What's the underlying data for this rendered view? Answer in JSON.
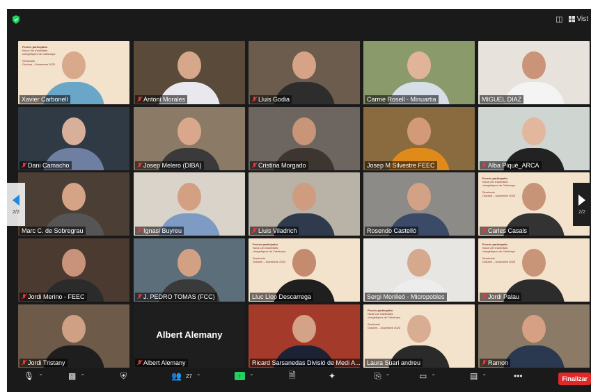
{
  "window": {
    "view_label": "Vist"
  },
  "pager": {
    "left_label": "2/2",
    "right_label": "2/2"
  },
  "participants": [
    {
      "name": "Xavier Carbonell",
      "muted": false,
      "bg": "#f3e2cc",
      "shirt": "#6aa6c7",
      "skin": "#d9a98b",
      "slide": true
    },
    {
      "name": "Antoni Morales",
      "muted": true,
      "bg": "#5a4a3a",
      "shirt": "#e8e8ee",
      "skin": "#d6a78a",
      "slide": false
    },
    {
      "name": "Lluis Godia",
      "muted": true,
      "bg": "#6b5c4d",
      "shirt": "#2d2d2d",
      "skin": "#d7a387",
      "slide": false
    },
    {
      "name": "Carme Rosell - Minuartia",
      "muted": false,
      "bg": "#8a9a6b",
      "shirt": "#d6dfe8",
      "skin": "#e1b49a",
      "slide": false
    },
    {
      "name": "MIGUEL DIAZ",
      "muted": false,
      "bg": "#e7e2dc",
      "shirt": "#f4f4f4",
      "skin": "#c99478",
      "slide": false
    },
    {
      "name": "Dani Camacho",
      "muted": true,
      "bg": "#2f3a44",
      "shirt": "#6f7fa2",
      "skin": "#d8b09a",
      "slide": false
    },
    {
      "name": "Josep Melero (DIBA)",
      "muted": true,
      "bg": "#8b7a66",
      "shirt": "#3a3a3a",
      "skin": "#d9a78c",
      "slide": false
    },
    {
      "name": "Cristina Morgado",
      "muted": true,
      "bg": "#6c6560",
      "shirt": "#3d3530",
      "skin": "#c89579",
      "slide": false
    },
    {
      "name": "Josep M Silvestre FEEC",
      "muted": false,
      "bg": "#8a6a3f",
      "shirt": "#e08a1a",
      "skin": "#d39a7a",
      "slide": false
    },
    {
      "name": "Alba Piqué_ARCA",
      "muted": true,
      "bg": "#cfd6d2",
      "shirt": "#222222",
      "skin": "#e2b79d",
      "slide": false
    },
    {
      "name": "Marc C. de Sobregrau",
      "muted": false,
      "bg": "#4b3f35",
      "shirt": "#555555",
      "skin": "#d5a487",
      "slide": false
    },
    {
      "name": "Ignasi Buyreu",
      "muted": true,
      "bg": "#d9d3c9",
      "shirt": "#7e9bc4",
      "skin": "#d4a083",
      "slide": false
    },
    {
      "name": "Lluis Viladrich",
      "muted": true,
      "bg": "#b9b2a6",
      "shirt": "#2f3b4d",
      "skin": "#cf9c80",
      "slide": false
    },
    {
      "name": "Rosendo Castelló",
      "muted": false,
      "bg": "#8d8b87",
      "shirt": "#3b4a66",
      "skin": "#d3a286",
      "slide": false,
      "active": true
    },
    {
      "name": "Carles Casals",
      "muted": true,
      "bg": "#f3e2cc",
      "shirt": "#333333",
      "skin": "#c79478",
      "slide": true
    },
    {
      "name": "Jordi Merino - FEEC",
      "muted": true,
      "bg": "#4a3a30",
      "shirt": "#2b2b2b",
      "skin": "#c8937a",
      "slide": false
    },
    {
      "name": "J. PEDRO TOMAS (FCC)",
      "muted": true,
      "bg": "#5b6e7a",
      "shirt": "#3a3a3a",
      "skin": "#d2a083",
      "slide": false
    },
    {
      "name": "Lluc Llop Descarrega",
      "muted": false,
      "bg": "#f3e2cc",
      "shirt": "#1f1f1f",
      "skin": "#c48b6e",
      "slide": true
    },
    {
      "name": "Sergi Monlleó - Micropobles",
      "muted": false,
      "bg": "#e8e6e2",
      "shirt": "#ededed",
      "skin": "#d6a88d",
      "slide": false
    },
    {
      "name": "Jordi Palau",
      "muted": true,
      "bg": "#f3e2cc",
      "shirt": "#2c2c2c",
      "skin": "#c99578",
      "slide": true
    },
    {
      "name": "Jordi Tristany",
      "muted": true,
      "bg": "#6d5a48",
      "shirt": "#1e1e1e",
      "skin": "#d0a084",
      "slide": false
    },
    {
      "name": "Albert Alemany",
      "muted": true,
      "bg": "#1e1e1e",
      "shirt": "#1e1e1e",
      "skin": "#1e1e1e",
      "slide": false,
      "no_video": true
    },
    {
      "name": "Ricard Sarsanedas Divisió de Medi A...",
      "muted": false,
      "bg": "#a43a2a",
      "shirt": "#1c2233",
      "skin": "#d4a286",
      "slide": false
    },
    {
      "name": "Laura Suari andreu",
      "muted": false,
      "bg": "#f3e2cc",
      "shirt": "#2a2a2a",
      "skin": "#d9ad92",
      "slide": true
    },
    {
      "name": "Ramon",
      "muted": true,
      "bg": "#8a7a66",
      "shirt": "#2a3850",
      "skin": "#d5a083",
      "slide": false
    }
  ],
  "slide_text": [
    "Procés participatiu",
    "Nova Llei d'activitats",
    "cinegètiques de Catalunya",
    "",
    "Seminaris",
    "Octubre – Novembre 2023"
  ],
  "toolbar": {
    "participants_count": "27",
    "end_label": "Finalizar"
  }
}
